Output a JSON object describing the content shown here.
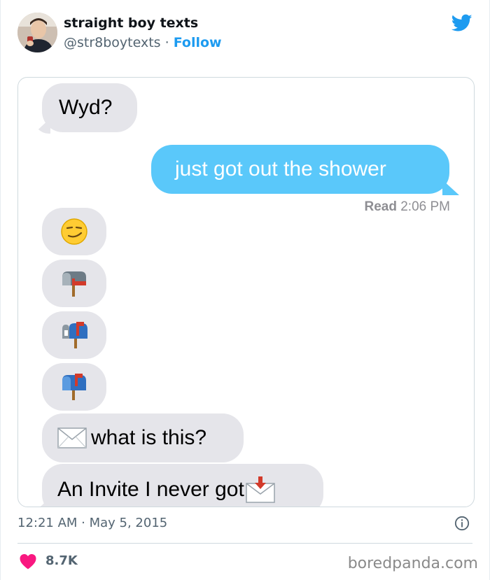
{
  "tweet": {
    "display_name": "straight boy texts",
    "handle": "@str8boytexts",
    "separator": "·",
    "follow_label": "Follow",
    "timestamp": "12:21 AM · May 5, 2015",
    "like_count": "8.7K",
    "icons": {
      "brand": "twitter-bird-icon",
      "info": "info-icon",
      "like": "heart-icon"
    },
    "colors": {
      "accent": "#1d9bf0",
      "like": "#f91880"
    }
  },
  "conversation": {
    "messages": [
      {
        "from": "them",
        "text": "Wyd?"
      },
      {
        "from": "me",
        "text": "just got out the shower"
      },
      {
        "from": "them",
        "emoji": "smirking-face"
      },
      {
        "from": "them",
        "emoji": "closed-mailbox-lowered-flag"
      },
      {
        "from": "them",
        "emoji": "open-mailbox-raised-flag"
      },
      {
        "from": "them",
        "emoji": "closed-mailbox-raised-flag"
      },
      {
        "from": "them",
        "emoji": "envelope",
        "text": "what is this?"
      },
      {
        "from": "them",
        "emoji": "incoming-envelope",
        "text": "An Invite I never got"
      }
    ],
    "read_label": "Read",
    "read_time": "2:06 PM",
    "colors": {
      "sent": "#5ac8fa",
      "received": "#e5e5ea"
    }
  },
  "watermark": "boredpanda.com"
}
